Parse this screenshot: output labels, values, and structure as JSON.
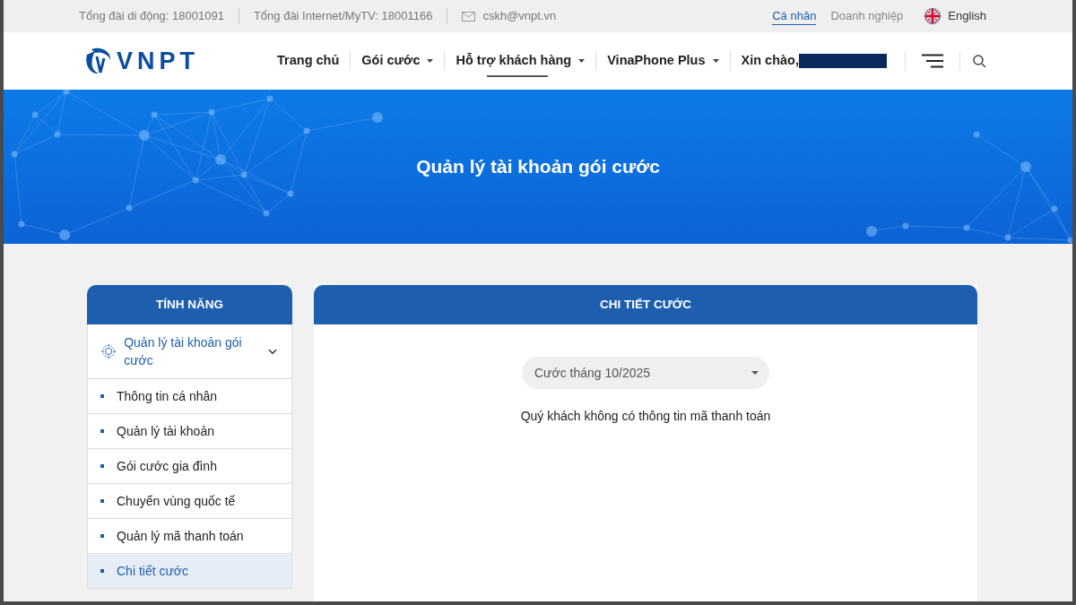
{
  "top_bar": {
    "hotlines": [
      "Tổng đài di động: 18001091",
      "Tổng đài Internet/MyTV: 18001166"
    ],
    "email": "cskh@vnpt.vn",
    "segments": [
      {
        "label": "Cá nhân",
        "selected": true
      },
      {
        "label": "Doanh nghiệp",
        "selected": false
      }
    ],
    "language": "English"
  },
  "header": {
    "logo": "VNPT",
    "nav": [
      {
        "label": "Trang chủ",
        "dropdown": false,
        "selected": false
      },
      {
        "label": "Gói cước",
        "dropdown": true,
        "selected": false
      },
      {
        "label": "Hỗ trợ khách hàng",
        "dropdown": true,
        "selected": true
      },
      {
        "label": "VinaPhone Plus",
        "dropdown": true,
        "selected": false
      }
    ],
    "greeting": "Xin chào,"
  },
  "banner": {
    "title": "Quản lý tài khoản gói cước"
  },
  "sidebar": {
    "title": "TÍNH NĂNG",
    "groups": [
      {
        "label": "Quản lý tài khoản gói cước",
        "expanded": true,
        "children": [
          {
            "label": "Thông tin cá nhân",
            "selected": false
          },
          {
            "label": "Quản lý tài khoản",
            "selected": false
          },
          {
            "label": "Gói cước gia đình",
            "selected": false
          },
          {
            "label": "Chuyển vùng quốc tế",
            "selected": false
          },
          {
            "label": "Quản lý mã thanh toán",
            "selected": false
          },
          {
            "label": "Chi tiết cước",
            "selected": true
          }
        ]
      }
    ]
  },
  "panel": {
    "title": "CHI TIẾT CƯỚC",
    "period_select": {
      "value": "Cước tháng 10/2025"
    },
    "message": "Quý khách không có thông tin mã thanh toán"
  }
}
